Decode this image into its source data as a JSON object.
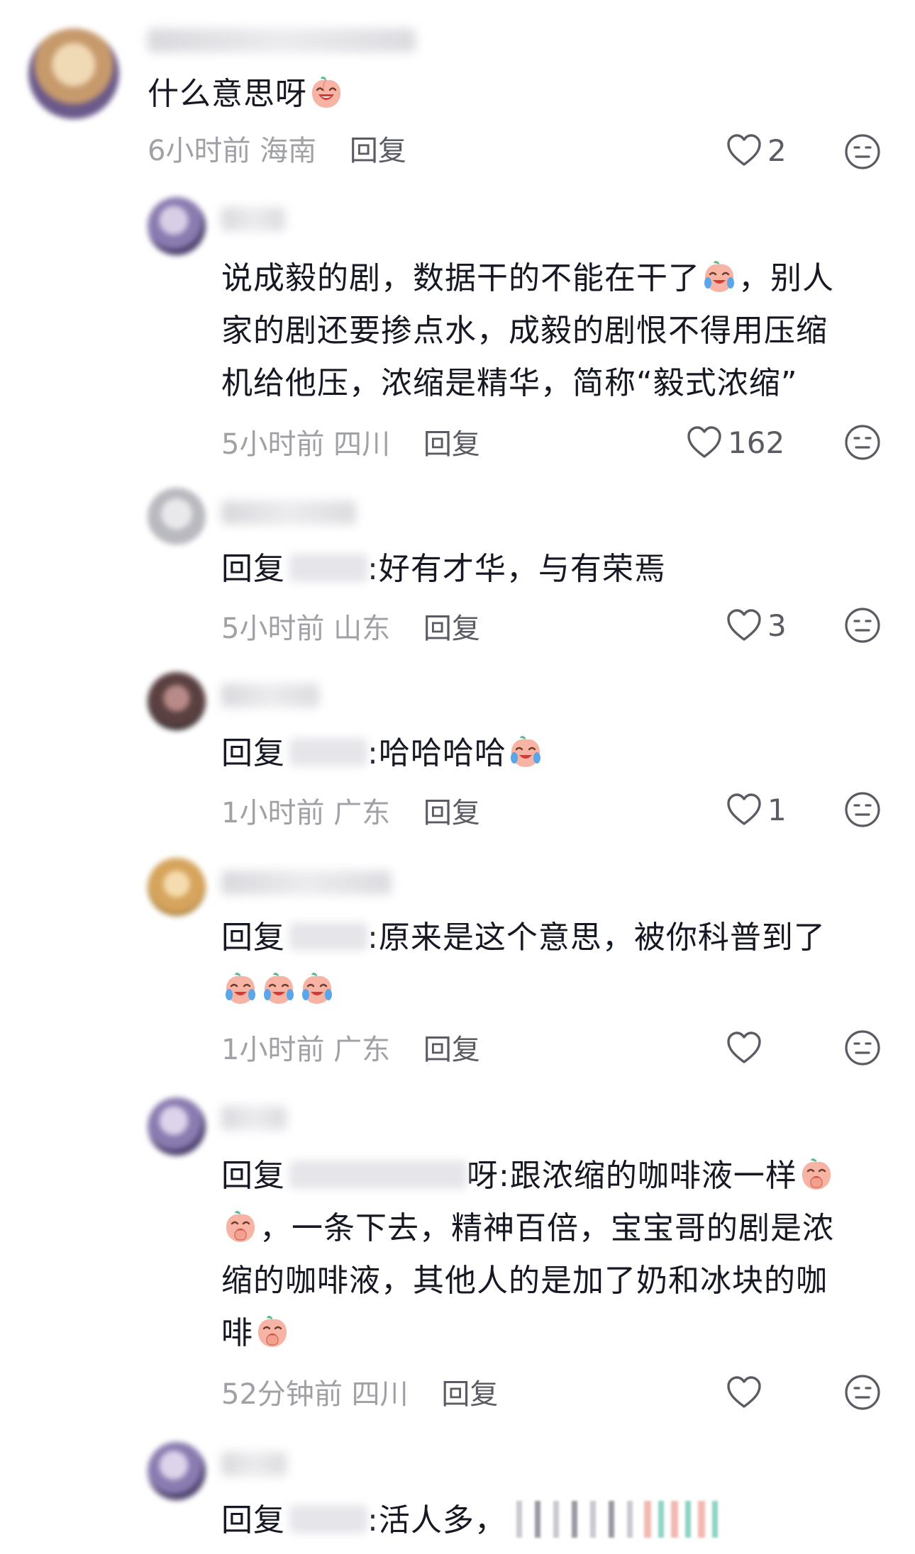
{
  "comments": [
    {
      "text": "什么意思呀",
      "time": "6小时前",
      "location": "海南",
      "reply_label": "回复",
      "likes": "2"
    },
    {
      "line1": "说成毅的剧，数据干的不能在干了",
      "line1_tail": "，别人",
      "line2": "家的剧还要掺点水，成毅的剧恨不得用压缩",
      "line3": "机给他压，浓缩是精华，简称“毅式浓缩”",
      "time": "5小时前",
      "location": "四川",
      "reply_label": "回复",
      "likes": "162"
    },
    {
      "prefix": "回复",
      "text": ":好有才华，与有荣焉",
      "time": "5小时前",
      "location": "山东",
      "reply_label": "回复",
      "likes": "3"
    },
    {
      "prefix": "回复",
      "text": ":哈哈哈哈",
      "time": "1小时前",
      "location": "广东",
      "reply_label": "回复",
      "likes": "1"
    },
    {
      "prefix": "回复",
      "text": ":原来是这个意思，被你科普到了",
      "time": "1小时前",
      "location": "广东",
      "reply_label": "回复",
      "likes": ""
    },
    {
      "prefix": "回复",
      "name_tail": "呀",
      "line1": ":跟浓缩的咖啡液一样",
      "line2": "，一条下去，精神百倍，宝宝哥的剧是浓",
      "line3": "缩的咖啡液，其他人的是加了奶和冰块的咖",
      "line4": "啡",
      "time": "52分钟前",
      "location": "四川",
      "reply_label": "回复",
      "likes": ""
    },
    {
      "prefix": "回复",
      "text": ":活人多，"
    }
  ],
  "colors": {
    "text": "#161823",
    "meta": "#a0a1a7",
    "reply": "#5a5b63"
  },
  "icons": {
    "like": "heart-outline-icon",
    "dislike": "meh-face-icon",
    "emoji": "peach-face-emoji"
  }
}
